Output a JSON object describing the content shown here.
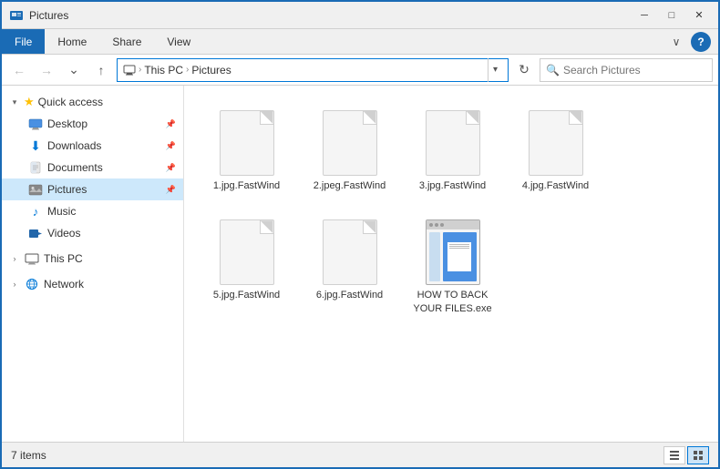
{
  "titleBar": {
    "title": "Pictures",
    "minimize": "─",
    "maximize": "□",
    "close": "✕"
  },
  "ribbon": {
    "tabs": [
      "File",
      "Home",
      "Share",
      "View"
    ],
    "activeTab": "File",
    "chevron": "∨",
    "help": "?"
  },
  "navBar": {
    "back": "←",
    "forward": "→",
    "up": "↑",
    "dropdownArrow": "▾",
    "refresh": "↻",
    "addressParts": [
      "This PC",
      "Pictures"
    ],
    "searchPlaceholder": "Search Pictures"
  },
  "sidebar": {
    "quickAccess": {
      "label": "Quick access",
      "expanded": true,
      "items": [
        {
          "name": "Desktop",
          "pinned": true
        },
        {
          "name": "Downloads",
          "pinned": true
        },
        {
          "name": "Documents",
          "pinned": true
        },
        {
          "name": "Pictures",
          "pinned": true,
          "active": true
        },
        {
          "name": "Music"
        },
        {
          "name": "Videos"
        }
      ]
    },
    "thisPC": {
      "label": "This PC",
      "expanded": false
    },
    "network": {
      "label": "Network",
      "expanded": false
    }
  },
  "files": [
    {
      "id": 1,
      "name": "1.jpg.FastWind",
      "type": "generic"
    },
    {
      "id": 2,
      "name": "2.jpeg.FastWind",
      "type": "generic"
    },
    {
      "id": 3,
      "name": "3.jpg.FastWind",
      "type": "generic"
    },
    {
      "id": 4,
      "name": "4.jpg.FastWind",
      "type": "generic"
    },
    {
      "id": 5,
      "name": "5.jpg.FastWind",
      "type": "generic"
    },
    {
      "id": 6,
      "name": "6.jpg.FastWind",
      "type": "generic"
    },
    {
      "id": 7,
      "name": "HOW TO BACK YOUR FILES.exe",
      "type": "howto"
    }
  ],
  "statusBar": {
    "count": "7",
    "items": "items"
  }
}
